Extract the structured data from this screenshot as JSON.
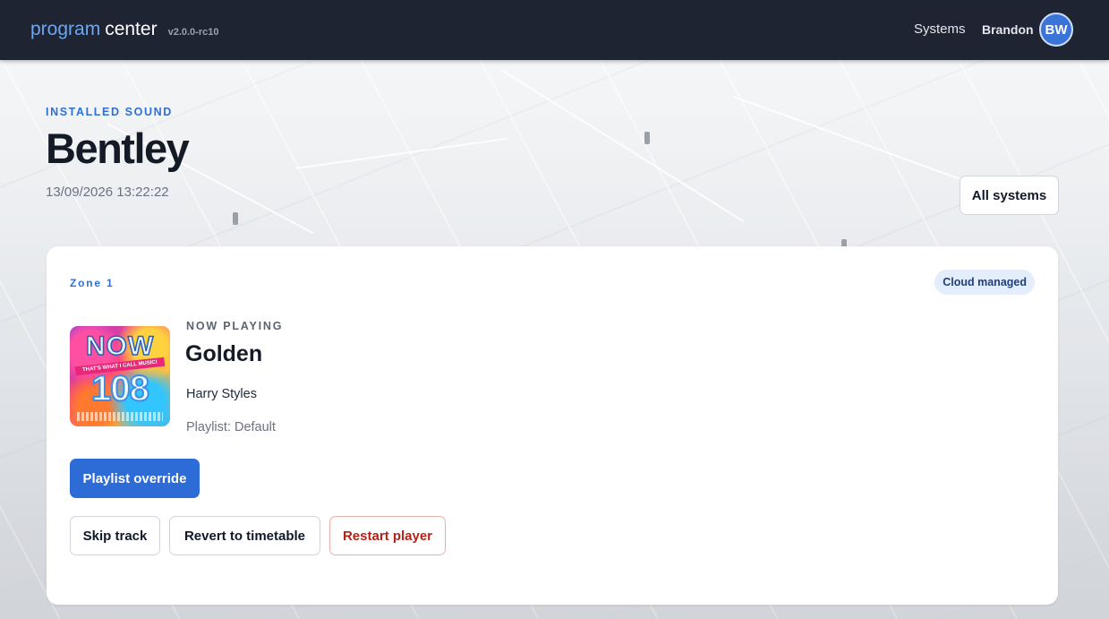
{
  "header": {
    "brand_first": "program",
    "brand_second": "center",
    "version": "v2.0.0-rc10",
    "nav_systems": "Systems",
    "user_name": "Brandon",
    "avatar_initials": "BW"
  },
  "page": {
    "eyebrow": "INSTALLED SOUND",
    "title": "Bentley",
    "timestamp": "13/09/2026 13:22:22",
    "all_systems_label": "All systems"
  },
  "zone": {
    "label": "Zone 1",
    "badge": "Cloud managed",
    "cover_art": {
      "top_text": "NOW",
      "strip_text": "THAT'S WHAT I CALL MUSIC!",
      "number": "108"
    },
    "now_playing_label": "NOW PLAYING",
    "track_title": "Golden",
    "artist": "Harry Styles",
    "playlist": "Playlist: Default",
    "buttons": {
      "playlist_override": "Playlist override",
      "skip_track": "Skip track",
      "revert_timetable": "Revert to timetable",
      "restart_player": "Restart player"
    }
  },
  "colors": {
    "header_bg": "#1e2432",
    "accent_blue": "#2d6bd6",
    "danger_red": "#b42318",
    "badge_bg": "#e4edfb"
  },
  "icons": [
    "avatar"
  ]
}
